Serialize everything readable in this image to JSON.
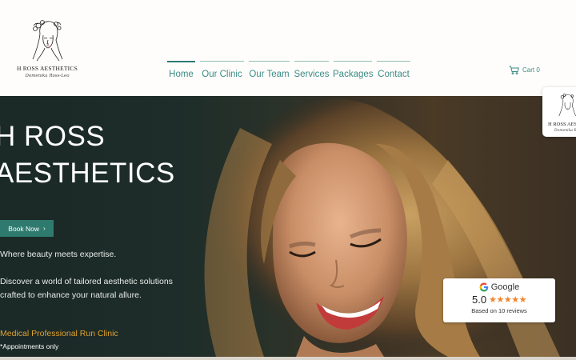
{
  "brand": {
    "name": "H ROSS AESTHETICS",
    "signature": "Domenika Ross-Leo"
  },
  "nav": {
    "items": [
      {
        "label": "Home",
        "active": true
      },
      {
        "label": "Our Clinic",
        "active": false
      },
      {
        "label": "Our Team",
        "active": false
      },
      {
        "label": "Services",
        "active": false
      },
      {
        "label": "Packages",
        "active": false
      },
      {
        "label": "Contact",
        "active": false
      }
    ]
  },
  "cart": {
    "label": "Cart",
    "count": "0",
    "icon": "cart-icon"
  },
  "hero": {
    "title_line1": "H ROSS",
    "title_line2": "AESTHETICS",
    "cta_label": "Book Now",
    "cta_icon": "chevron-right-icon",
    "tagline": "Where beauty meets expertise.",
    "description_line1": "Discover a world of tailored aesthetic solutions",
    "description_line2": "crafted to enhance your natural allure.",
    "highlight": "Medical Professional Run Clinic",
    "note": "*Appointments only"
  },
  "review": {
    "provider": "Google",
    "score": "5.0",
    "stars": "★★★★★",
    "star_count": 5,
    "summary": "Based on 10 reviews"
  },
  "colors": {
    "accent": "#3a8c86",
    "button": "#2f7a6f",
    "highlight": "#e0a12f",
    "stars": "#f4822a"
  }
}
